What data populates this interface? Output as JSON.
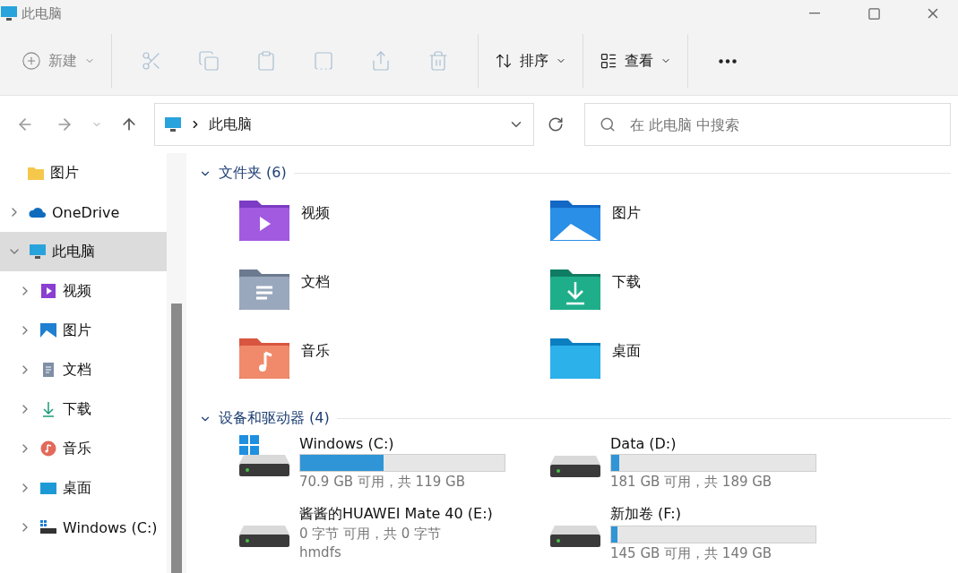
{
  "window": {
    "title": "此电脑"
  },
  "toolbar": {
    "new_label": "新建",
    "actions": [
      {
        "kind": "cut",
        "disabled": true
      },
      {
        "kind": "copy",
        "disabled": true
      },
      {
        "kind": "paste",
        "disabled": true
      },
      {
        "kind": "rename",
        "disabled": true
      },
      {
        "kind": "share",
        "disabled": true
      },
      {
        "kind": "delete",
        "disabled": true
      }
    ],
    "sort_label": "排序",
    "view_label": "查看"
  },
  "address": {
    "path": "此电脑",
    "search_placeholder": "在 此电脑 中搜索"
  },
  "sidebar": {
    "items": [
      {
        "label": "图片",
        "kind": "folder",
        "expandable": false,
        "selected": false
      },
      {
        "label": "OneDrive",
        "kind": "cloud",
        "expandable": true,
        "expanded": false,
        "selected": false
      },
      {
        "label": "此电脑",
        "kind": "pc",
        "expandable": true,
        "expanded": true,
        "selected": true,
        "children": [
          {
            "label": "视频",
            "kind": "video",
            "expandable": true,
            "expanded": false,
            "selected": false
          },
          {
            "label": "图片",
            "kind": "pictures",
            "expandable": true,
            "expanded": false,
            "selected": false
          },
          {
            "label": "文档",
            "kind": "documents",
            "expandable": true,
            "expanded": false,
            "selected": false
          },
          {
            "label": "下载",
            "kind": "download",
            "expandable": true,
            "expanded": false,
            "selected": false
          },
          {
            "label": "音乐",
            "kind": "music",
            "expandable": true,
            "expanded": false,
            "selected": false
          },
          {
            "label": "桌面",
            "kind": "desktop",
            "expandable": true,
            "expanded": false,
            "selected": false
          },
          {
            "label": "Windows (C:)",
            "kind": "drive",
            "expandable": true,
            "expanded": false,
            "selected": false
          }
        ]
      }
    ]
  },
  "folders_section": {
    "title": "文件夹 (6)",
    "expanded": true,
    "items": [
      {
        "name": "视频",
        "kind": "video"
      },
      {
        "name": "图片",
        "kind": "pictures"
      },
      {
        "name": "文档",
        "kind": "documents"
      },
      {
        "name": "下载",
        "kind": "download"
      },
      {
        "name": "音乐",
        "kind": "music"
      },
      {
        "name": "桌面",
        "kind": "desktop"
      }
    ]
  },
  "drives_section": {
    "title": "设备和驱动器 (4)",
    "expanded": true,
    "items": [
      {
        "name": "Windows (C:)",
        "kind": "system",
        "level": 0.41,
        "free": "70.9 GB 可用，共 119 GB"
      },
      {
        "name": "Data (D:)",
        "kind": "disk",
        "level": 0.04,
        "free": "181 GB 可用，共 189 GB"
      },
      {
        "name": "酱酱的HUAWEI Mate 40 (E:)",
        "kind": "device",
        "free": "0 字节 可用，共 0 字节",
        "detail": "hmdfs"
      },
      {
        "name": "新加卷 (F:)",
        "kind": "disk",
        "level": 0.03,
        "free": "145 GB 可用，共 149 GB"
      }
    ]
  }
}
